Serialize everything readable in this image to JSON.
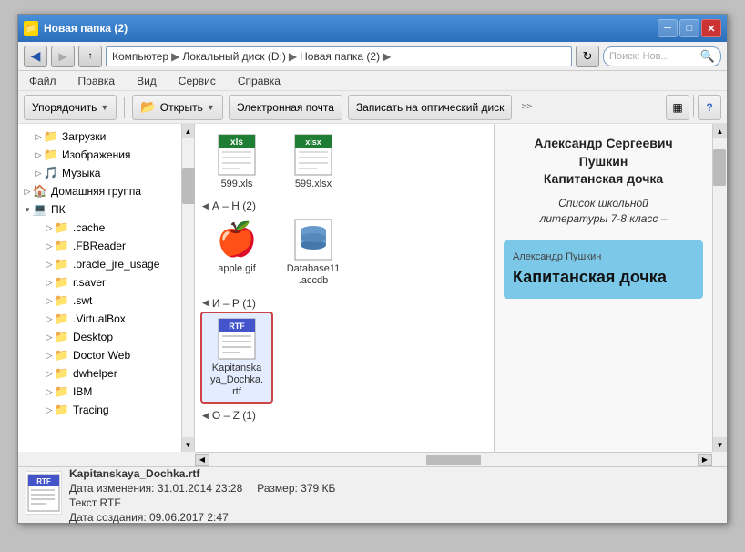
{
  "window": {
    "title": "Новая папка (2)",
    "minimize": "─",
    "maximize": "□",
    "close": "✕"
  },
  "addressBar": {
    "back": "◀",
    "forward": "▶",
    "up": "↑",
    "pathSegments": [
      "Компьютер",
      "Локальный диск (D:)",
      "Новая папка (2)"
    ],
    "refreshBtn": "↻",
    "searchPlaceholder": "Поиск: Нов..."
  },
  "menu": {
    "items": [
      "Файл",
      "Правка",
      "Вид",
      "Сервис",
      "Справка"
    ]
  },
  "toolbar": {
    "organize": "Упорядочить",
    "open": "Открыть",
    "email": "Электронная почта",
    "burn": "Записать на оптический диск"
  },
  "sidebar": {
    "items": [
      {
        "label": "Загрузки",
        "level": 2,
        "icon": "folder",
        "expanded": false
      },
      {
        "label": "Изображения",
        "level": 2,
        "icon": "folder",
        "expanded": false
      },
      {
        "label": "Музыка",
        "level": 2,
        "icon": "music-folder",
        "expanded": false
      },
      {
        "label": "Домашняя группа",
        "level": 1,
        "icon": "home",
        "expanded": false
      },
      {
        "label": "ПК",
        "level": 1,
        "icon": "pc",
        "expanded": true
      },
      {
        "label": ".cache",
        "level": 3,
        "icon": "folder",
        "expanded": false
      },
      {
        "label": ".FBReader",
        "level": 3,
        "icon": "folder",
        "expanded": false
      },
      {
        "label": ".oracle_jre_usage",
        "level": 3,
        "icon": "folder",
        "expanded": false
      },
      {
        "label": "r.saver",
        "level": 3,
        "icon": "folder",
        "expanded": false
      },
      {
        "label": ".swt",
        "level": 3,
        "icon": "folder",
        "expanded": false
      },
      {
        "label": ".VirtualBox",
        "level": 3,
        "icon": "folder",
        "expanded": false
      },
      {
        "label": "Desktop",
        "level": 3,
        "icon": "folder",
        "expanded": false
      },
      {
        "label": "Doctor Web",
        "level": 3,
        "icon": "folder",
        "expanded": false
      },
      {
        "label": "dwhelper",
        "level": 3,
        "icon": "folder",
        "expanded": false
      },
      {
        "label": "IBM",
        "level": 3,
        "icon": "folder",
        "expanded": false
      },
      {
        "label": "Tracing",
        "level": 3,
        "icon": "folder",
        "expanded": false
      }
    ]
  },
  "fileGroups": [
    {
      "label": "А – Н (2)",
      "files": [
        {
          "name": "apple.gif",
          "type": "gif",
          "selected": false
        },
        {
          "name": "Database11\n.accdb",
          "type": "db",
          "selected": false
        }
      ]
    },
    {
      "label": "И – Р (1)",
      "files": [
        {
          "name": "Kapitanska\nya_Dochka.\nrtf",
          "type": "rtf",
          "selected": true
        }
      ]
    },
    {
      "label": "О – Z (1)",
      "files": []
    }
  ],
  "topFiles": [
    {
      "name": "599.xls",
      "type": "xls"
    },
    {
      "name": "599.xlsx",
      "type": "xlsx"
    }
  ],
  "preview": {
    "title": "Александр Сергеевич\nПушкин\nКапитанская дочка",
    "subtitle": "Список школьной\nлитературы 7-8 класс –",
    "bookAuthor": "Александр Пушкин",
    "bookTitle": "Капитанская дочка"
  },
  "statusBar": {
    "filename": "Kapitanskaya_Dochka.rtf",
    "fileType": "Текст RTF",
    "dateModified": "Дата изменения: 31.01.2014 23:28",
    "size": "Размер: 379 КБ",
    "dateCreated": "Дата создания: 09.06.2017 2:47"
  }
}
